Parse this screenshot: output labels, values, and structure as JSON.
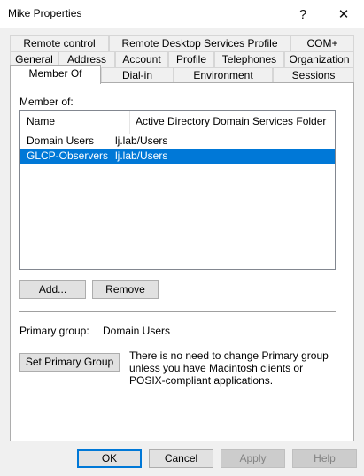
{
  "window": {
    "title": "Mike Properties",
    "help_glyph": "?",
    "close_glyph": "✕"
  },
  "tabs": {
    "row1": [
      "Remote control",
      "Remote Desktop Services Profile",
      "COM+"
    ],
    "row2": [
      "General",
      "Address",
      "Account",
      "Profile",
      "Telephones",
      "Organization"
    ],
    "row3": [
      "Member Of",
      "Dial-in",
      "Environment",
      "Sessions"
    ],
    "active": "Member Of"
  },
  "member_of": {
    "label": "Member of:",
    "columns": [
      "Name",
      "Active Directory Domain Services Folder"
    ],
    "rows": [
      {
        "name": "Domain Users",
        "folder": "lj.lab/Users",
        "selected": false
      },
      {
        "name": "GLCP-Observers",
        "folder": "lj.lab/Users",
        "selected": true
      }
    ],
    "add_label": "Add...",
    "remove_label": "Remove"
  },
  "primary_group": {
    "label": "Primary group:",
    "value": "Domain Users",
    "set_button_label": "Set Primary Group",
    "info": "There is no need to change Primary group unless you have Macintosh clients or POSIX-compliant applications."
  },
  "footer": {
    "ok": "OK",
    "cancel": "Cancel",
    "apply": "Apply",
    "help": "Help"
  },
  "colors": {
    "selection": "#0078d7",
    "default_button_border": "#0078d7"
  }
}
